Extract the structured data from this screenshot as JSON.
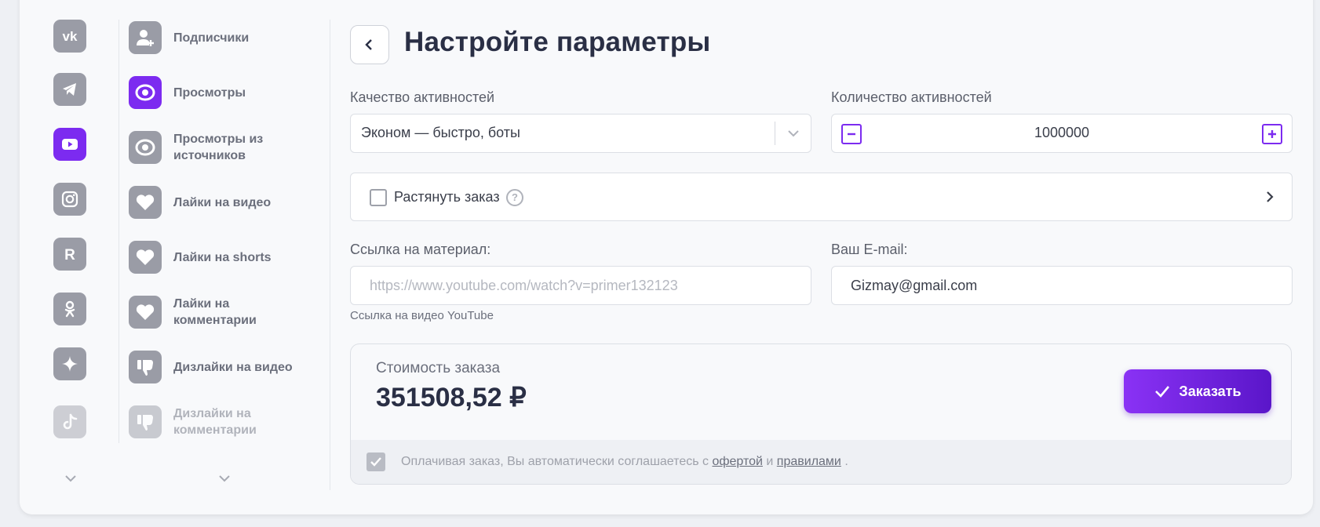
{
  "platforms": [
    {
      "name": "vk",
      "icon": "vk-icon",
      "active": false
    },
    {
      "name": "telegram",
      "icon": "telegram-icon",
      "active": false
    },
    {
      "name": "youtube",
      "icon": "youtube-icon",
      "active": true
    },
    {
      "name": "instagram",
      "icon": "instagram-icon",
      "active": false
    },
    {
      "name": "rutube",
      "icon": "rutube-icon",
      "active": false
    },
    {
      "name": "odnoklassniki",
      "icon": "ok-icon",
      "active": false
    },
    {
      "name": "dzen",
      "icon": "sparkle-icon",
      "active": false
    },
    {
      "name": "tiktok",
      "icon": "tiktok-icon",
      "active": false
    }
  ],
  "services": [
    {
      "label": "Подписчики",
      "icon": "add-user-icon",
      "active": false
    },
    {
      "label": "Просмотры",
      "icon": "eye-icon",
      "active": true
    },
    {
      "label": "Просмотры из источников",
      "icon": "eye-icon",
      "active": false
    },
    {
      "label": "Лайки на видео",
      "icon": "heart-icon",
      "active": false
    },
    {
      "label": "Лайки на shorts",
      "icon": "heart-icon",
      "active": false
    },
    {
      "label": "Лайки на комментарии",
      "icon": "heart-icon",
      "active": false
    },
    {
      "label": "Дизлайки на видео",
      "icon": "thumbs-down-icon",
      "active": false
    },
    {
      "label": "Дизлайки на комментарии",
      "icon": "thumbs-down-icon",
      "active": false
    }
  ],
  "main": {
    "title": "Настройте параметры",
    "quality_label": "Качество активностей",
    "quality_value": "Эконом — быстро, боты",
    "quantity_label": "Количество активностей",
    "quantity_value": "1000000",
    "stretch_label": "Растянуть заказ",
    "help_glyph": "?",
    "link_label": "Ссылка на материал:",
    "link_placeholder": "https://www.youtube.com/watch?v=primer132123",
    "link_hint": "Ссылка на видео YouTube",
    "email_label": "Ваш E-mail:",
    "email_value": "Gizmay@gmail.com"
  },
  "order": {
    "cost_label": "Стоимость заказа",
    "cost_value": "351508,52 ₽",
    "button_label": "Заказать",
    "agree_prefix": "Оплачивая заказ, Вы автоматически соглашаетесь с",
    "agree_offer": "офертой",
    "agree_and": "и",
    "agree_rules": "правилами",
    "agree_suffix": "."
  },
  "colors": {
    "accent": "#7c2bf0",
    "icon_gray": "#9a9ca6",
    "title": "#2a2f45"
  }
}
